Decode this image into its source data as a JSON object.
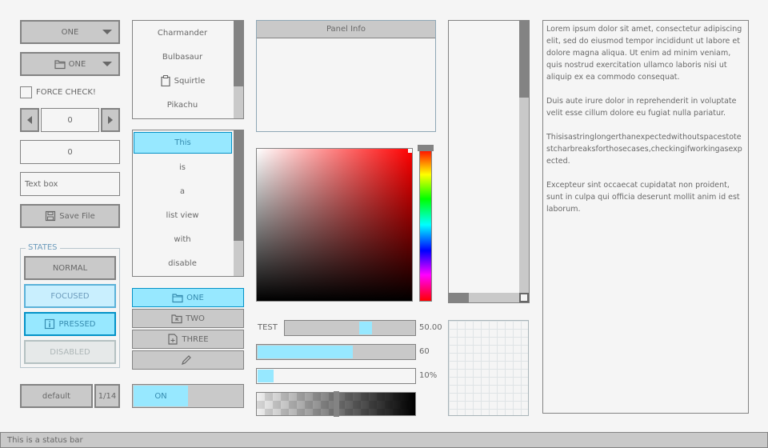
{
  "dropdown_one": {
    "selected": "ONE"
  },
  "dropdown_icon": {
    "selected": "ONE",
    "icon": "folder-icon"
  },
  "checkbox": {
    "label": "FORCE CHECK!",
    "checked": false
  },
  "spinner": {
    "value": "0"
  },
  "value_box": {
    "value": "0"
  },
  "text_box": {
    "value": "Text box"
  },
  "save_button": {
    "label": "Save File",
    "icon": "save-icon"
  },
  "states": {
    "title": "STATES",
    "normal": "NORMAL",
    "focused": "FOCUSED",
    "pressed": "PRESSED",
    "disabled": "DISABLED"
  },
  "bottom_left": {
    "default_label": "default",
    "page_counter": "1/14"
  },
  "list_top": {
    "items": [
      {
        "label": "Charmander",
        "icon": ""
      },
      {
        "label": "Bulbasaur",
        "icon": ""
      },
      {
        "label": "Squirtle",
        "icon": "clipboard-icon"
      },
      {
        "label": "Pikachu",
        "icon": ""
      }
    ]
  },
  "list_view": {
    "items": [
      "This",
      "is",
      "a",
      "list view",
      "with",
      "disable"
    ],
    "selected_index": 0
  },
  "toggle_group": {
    "items": [
      {
        "label": "ONE",
        "icon": "folder-icon",
        "active": true
      },
      {
        "label": "TWO",
        "icon": "folder-icon",
        "active": false
      },
      {
        "label": "THREE",
        "icon": "file-add-icon",
        "active": false
      },
      {
        "label": "",
        "icon": "pencil-icon",
        "active": false
      }
    ]
  },
  "toggle_on": {
    "label": "ON",
    "on": true
  },
  "panel": {
    "title": "Panel Info"
  },
  "slider_test": {
    "label": "TEST",
    "value_text": "50.00",
    "fraction": 0.62
  },
  "slider_bar": {
    "value_text": "60",
    "fraction": 0.6
  },
  "progress": {
    "value_text": "10%",
    "fraction": 0.1
  },
  "alpha_bar": {
    "fraction": 0.5
  },
  "textarea": {
    "paragraphs": [
      "Lorem ipsum dolor sit amet, consectetur adipiscing elit, sed do eiusmod tempor incididunt ut labore et dolore magna aliqua. Ut enim ad minim veniam, quis nostrud exercitation ullamco laboris nisi ut aliquip ex ea commodo consequat.",
      "Duis aute irure dolor in reprehenderit in voluptate velit esse cillum dolore eu fugiat nulla pariatur.",
      "Thisisastringlongerthanexpectedwithoutspacestotestcharbreaksforthosecases,checkingifworkingasexpected.",
      "Excepteur sint occaecat cupidatat non proident, sunt in culpa qui officia deserunt mollit anim id est laborum."
    ]
  },
  "status_bar": {
    "text": "This is a status bar"
  },
  "colors": {
    "accent_light": "#97e8ff",
    "accent_border": "#0492c7",
    "border": "#838383",
    "base": "#c9c9c9",
    "background": "#f5f5f5",
    "text": "#686868"
  }
}
